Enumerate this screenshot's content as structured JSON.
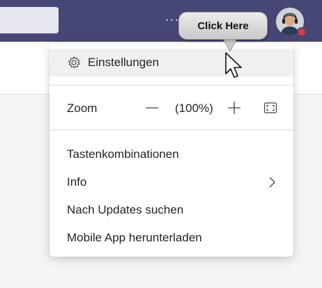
{
  "topbar": {
    "more_glyph": "···",
    "presence_color": "#e23a3a",
    "bar_color": "#464775"
  },
  "menu": {
    "settings_label": "Einstellungen",
    "zoom": {
      "label": "Zoom",
      "value": "(100%)",
      "minus_icon": "minus-icon",
      "plus_icon": "plus-icon",
      "fullscreen_icon": "fullscreen-icon"
    },
    "items": [
      {
        "label": "Tastenkombinationen"
      },
      {
        "label": "Info",
        "icon": "chevron-right-icon"
      },
      {
        "label": "Nach Updates suchen"
      },
      {
        "label": "Mobile App herunterladen"
      }
    ]
  },
  "annotation": {
    "callout_text": "Click Here"
  }
}
